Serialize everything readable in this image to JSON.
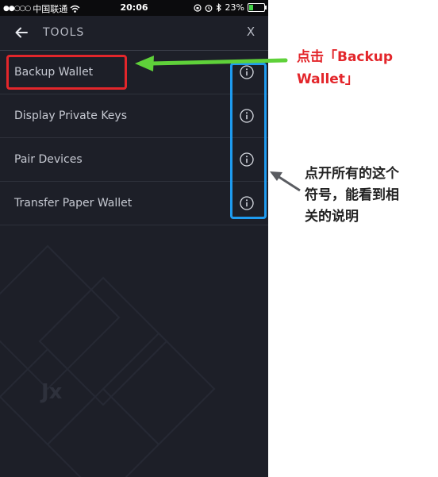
{
  "status_bar": {
    "signal": "●●○○○",
    "carrier": "中国联通",
    "time": "20:06",
    "battery": "23%",
    "battery_level": 0.23
  },
  "header": {
    "back_icon": "arrow-left-icon",
    "title": "TOOLS",
    "close_label": "X"
  },
  "items": [
    {
      "label": "Backup Wallet",
      "icon": "info-icon"
    },
    {
      "label": "Display Private Keys",
      "icon": "info-icon"
    },
    {
      "label": "Pair Devices",
      "icon": "info-icon"
    },
    {
      "label": "Transfer Paper Wallet",
      "icon": "info-icon"
    }
  ],
  "watermark": "Jx",
  "annotations": {
    "callout_1_line1": "点击「Backup",
    "callout_1_line2": "Wallet」",
    "callout_2_line1": "点开所有的这个",
    "callout_2_line2": "符号，能看到相",
    "callout_2_line3": "关的说明",
    "colors": {
      "red": "#e3262b",
      "blue": "#1e9bf0",
      "green": "#5fd13a"
    }
  }
}
